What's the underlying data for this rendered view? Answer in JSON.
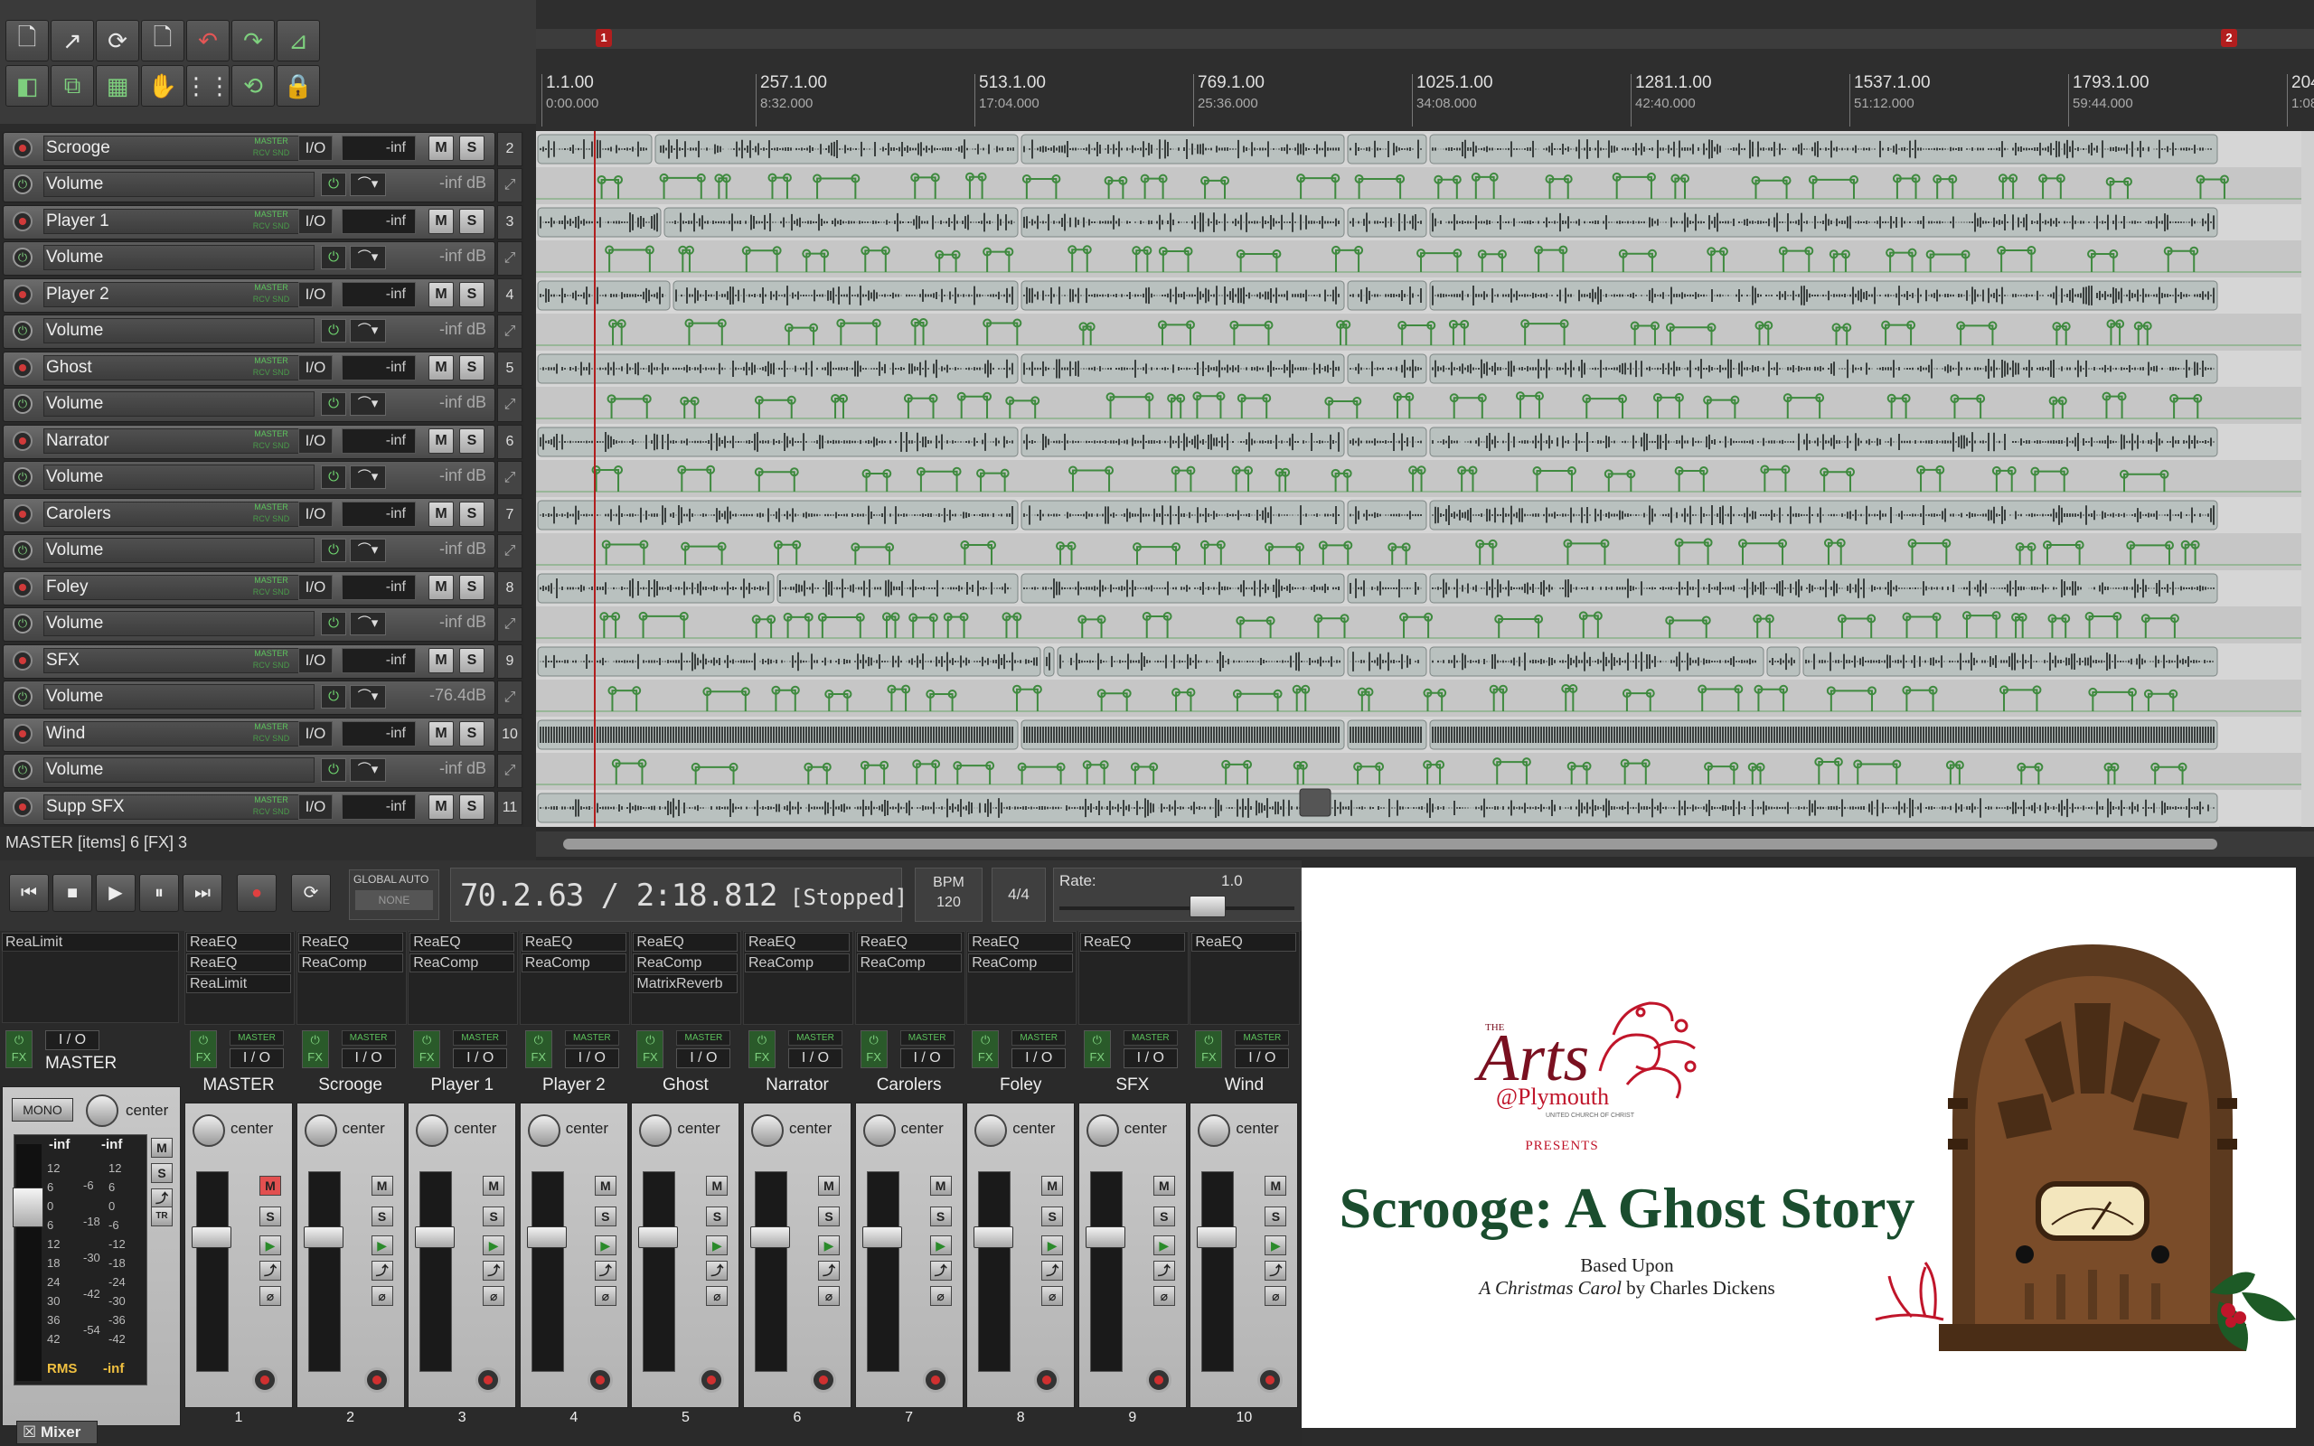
{
  "ruler": {
    "markers": [
      "1",
      "2"
    ],
    "ticks": [
      {
        "bar": "1.1.00",
        "time": "0:00.000"
      },
      {
        "bar": "257.1.00",
        "time": "8:32.000"
      },
      {
        "bar": "513.1.00",
        "time": "17:04.000"
      },
      {
        "bar": "769.1.00",
        "time": "25:36.000"
      },
      {
        "bar": "1025.1.00",
        "time": "34:08.000"
      },
      {
        "bar": "1281.1.00",
        "time": "42:40.000"
      },
      {
        "bar": "1537.1.00",
        "time": "51:12.000"
      },
      {
        "bar": "1793.1.00",
        "time": "59:44.000"
      },
      {
        "bar": "204",
        "time": "1:08"
      }
    ]
  },
  "tracks": [
    {
      "name": "Scrooge",
      "num": "2",
      "vol": "-inf",
      "env_label": "Volume",
      "env_val": "-inf dB"
    },
    {
      "name": "Player 1",
      "num": "3",
      "vol": "-inf",
      "env_label": "Volume",
      "env_val": "-inf dB"
    },
    {
      "name": "Player 2",
      "num": "4",
      "vol": "-inf",
      "env_label": "Volume",
      "env_val": "-inf dB"
    },
    {
      "name": "Ghost",
      "num": "5",
      "vol": "-inf",
      "env_label": "Volume",
      "env_val": "-inf dB"
    },
    {
      "name": "Narrator",
      "num": "6",
      "vol": "-inf",
      "env_label": "Volume",
      "env_val": "-inf dB"
    },
    {
      "name": "Carolers",
      "num": "7",
      "vol": "-inf",
      "env_label": "Volume",
      "env_val": "-inf dB"
    },
    {
      "name": "Foley",
      "num": "8",
      "vol": "-inf",
      "env_label": "Volume",
      "env_val": "-inf dB"
    },
    {
      "name": "SFX",
      "num": "9",
      "vol": "-inf",
      "env_label": "Volume",
      "env_val": "-76.4dB"
    },
    {
      "name": "Wind",
      "num": "10",
      "vol": "-inf",
      "env_label": "Volume",
      "env_val": "-inf dB"
    },
    {
      "name": "Supp SFX",
      "num": "11",
      "vol": "-inf"
    }
  ],
  "labels": {
    "master_send": "MASTER",
    "io": "I/O",
    "mute": "M",
    "solo": "S"
  },
  "infobar": "MASTER [items] 6 [FX] 3",
  "transport": {
    "global_auto": "GLOBAL AUTO",
    "none": "NONE",
    "time": "70.2.63 / 2:18.812",
    "state": "[Stopped]",
    "bpm_label": "BPM",
    "bpm": "120",
    "timesig": "4/4",
    "rate_label": "Rate:",
    "rate": "1.0"
  },
  "mixer": {
    "master": {
      "fx": [
        "ReaLimit"
      ],
      "name": "MASTER",
      "mono": "MONO",
      "pan": "center",
      "rms": "RMS",
      "rms_val": "-inf",
      "peak_l": "-inf",
      "peak_r": "-inf",
      "scale_l": [
        "12",
        "6",
        "0",
        "6",
        "12",
        "18",
        "24",
        "30",
        "36",
        "42"
      ],
      "scale_m": [
        "-6",
        "-18",
        "-30",
        "-42",
        "-54"
      ],
      "scale_r": [
        "12",
        "6",
        "0",
        "-6",
        "-12",
        "-18",
        "-24",
        "-30",
        "-36",
        "-42"
      ]
    },
    "strips": [
      {
        "name": "MASTER",
        "num": "1",
        "fx": [
          "ReaEQ",
          "ReaEQ",
          "ReaLimit"
        ]
      },
      {
        "name": "Scrooge",
        "num": "2",
        "fx": [
          "ReaEQ",
          "ReaComp"
        ]
      },
      {
        "name": "Player 1",
        "num": "3",
        "fx": [
          "ReaEQ",
          "ReaComp"
        ]
      },
      {
        "name": "Player 2",
        "num": "4",
        "fx": [
          "ReaEQ",
          "ReaComp"
        ]
      },
      {
        "name": "Ghost",
        "num": "5",
        "fx": [
          "ReaEQ",
          "ReaComp",
          "MatrixReverb"
        ]
      },
      {
        "name": "Narrator",
        "num": "6",
        "fx": [
          "ReaEQ",
          "ReaComp"
        ]
      },
      {
        "name": "Carolers",
        "num": "7",
        "fx": [
          "ReaEQ",
          "ReaComp"
        ]
      },
      {
        "name": "Foley",
        "num": "8",
        "fx": [
          "ReaEQ",
          "ReaComp"
        ]
      },
      {
        "name": "SFX",
        "num": "9",
        "fx": [
          "ReaEQ"
        ]
      },
      {
        "name": "Wind",
        "num": "10",
        "fx": [
          "ReaEQ"
        ]
      }
    ],
    "fx_label": "FX",
    "io_label": "I / O",
    "pan_label": "center",
    "tab": "Mixer"
  },
  "poster": {
    "logo_the": "THE",
    "logo_arts": "Arts",
    "logo_plymouth": "@Plymouth",
    "logo_sub": "UNITED CHURCH OF CHRIST",
    "presents": "PRESENTS",
    "title": "Scrooge: A Ghost Story",
    "based": "Based Upon",
    "carol_title": "A Christmas Carol",
    "carol_by": " by Charles Dickens"
  }
}
